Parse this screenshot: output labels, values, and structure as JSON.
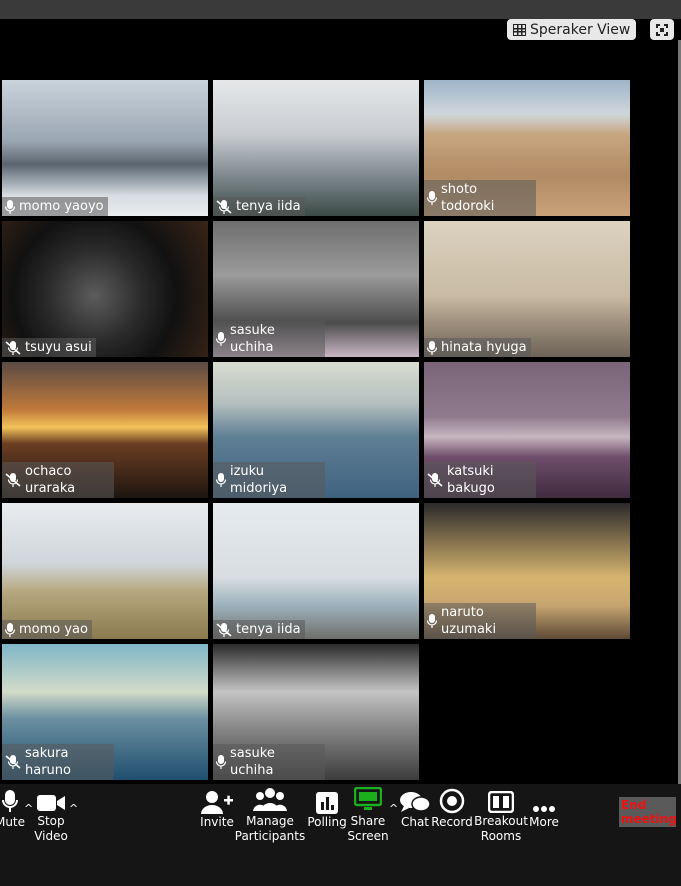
{
  "header": {
    "view_button_label": "Speraker View"
  },
  "participants": [
    {
      "name": "momo yaoyo",
      "muted": false
    },
    {
      "name": "tenya iida",
      "muted": true
    },
    {
      "name": "shoto todoroki",
      "muted": false
    },
    {
      "name": "tsuyu asui",
      "muted": true
    },
    {
      "name": "sasuke uchiha",
      "muted": false
    },
    {
      "name": "hinata hyuga",
      "muted": false
    },
    {
      "name": "ochaco uraraka",
      "muted": true
    },
    {
      "name": "izuku midoriya",
      "muted": false
    },
    {
      "name": "katsuki bakugo",
      "muted": true
    },
    {
      "name": "momo yao",
      "muted": false
    },
    {
      "name": "tenya iida",
      "muted": true
    },
    {
      "name": "naruto uzumaki",
      "muted": false
    },
    {
      "name": "sakura haruno",
      "muted": true
    },
    {
      "name": "sasuke uchiha",
      "muted": false
    }
  ],
  "toolbar": {
    "mute": "Mute",
    "stop_video": "Stop Video",
    "invite": "Invite",
    "manage_participants": "Manage Participants",
    "polling": "Polling",
    "share_screen": "Share Screen",
    "chat": "Chat",
    "record": "Record",
    "breakout_rooms": "Breakout Rooms",
    "more": "More",
    "end_meeting": "End meeting"
  },
  "colors": {
    "share_screen_icon": "#1bb01b",
    "end_meeting_text": "#e11111"
  }
}
